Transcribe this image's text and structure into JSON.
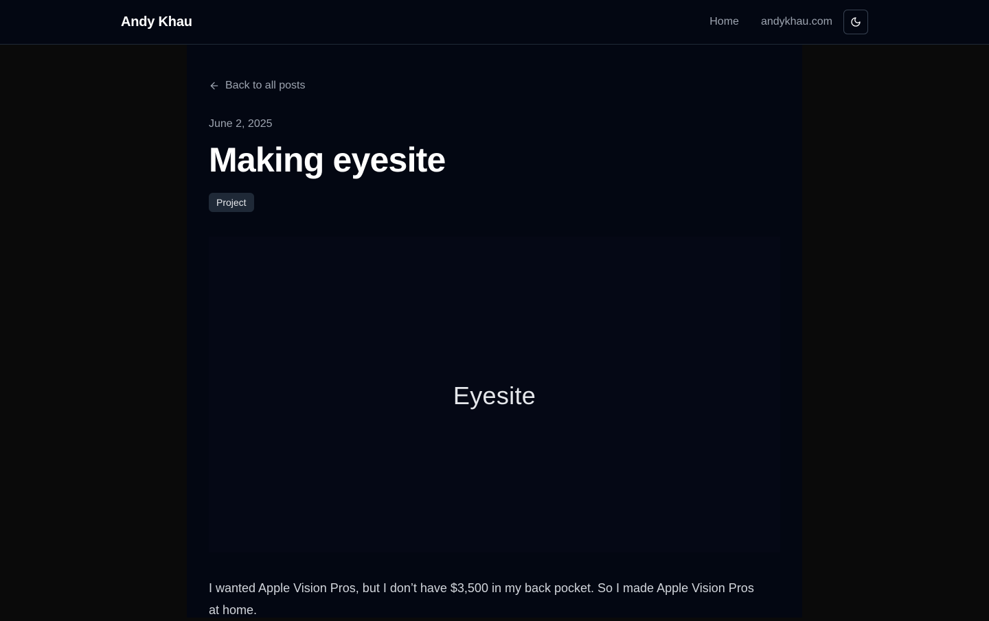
{
  "header": {
    "brand": "Andy Khau",
    "nav": [
      {
        "label": "Home"
      },
      {
        "label": "andykhau.com"
      }
    ],
    "theme_toggle_icon": "moon-icon"
  },
  "article": {
    "back_link": "Back to all posts",
    "back_icon": "arrow-left-icon",
    "date": "June 2, 2025",
    "title": "Making eyesite",
    "tags": [
      "Project"
    ],
    "hero_image_text": "Eyesite",
    "body": "I wanted Apple Vision Pros, but I don’t have $3,500 in my back pocket. So I made Apple Vision Pros at home."
  },
  "colors": {
    "page_background": "#0a0a0a",
    "content_background": "#030712",
    "text_primary": "#ffffff",
    "text_muted": "#9ca3af",
    "tag_background": "#1f2937"
  }
}
